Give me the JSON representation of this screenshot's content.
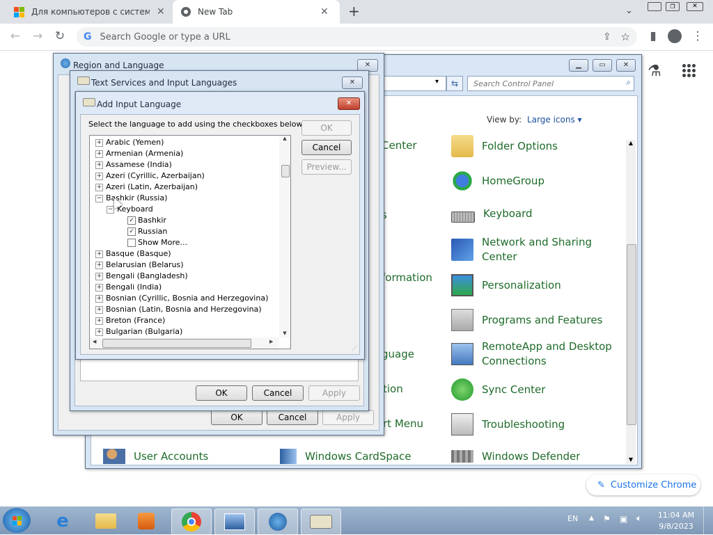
{
  "browser": {
    "tabs": [
      {
        "title": "Для компьютеров с системами"
      },
      {
        "title": "New Tab"
      }
    ],
    "new_tab_symbol": "+",
    "omnibox_placeholder": "Search Google or type a URL",
    "customize_label": "Customize Chrome"
  },
  "control_panel": {
    "search_placeholder": "Search Control Panel",
    "view_by_label": "View by:",
    "view_by_value": "Large icons",
    "items_right": [
      {
        "label": "Folder Options",
        "icon": "folder-options-icon"
      },
      {
        "label": "HomeGroup",
        "icon": "homegroup-icon"
      },
      {
        "label": "Keyboard",
        "icon": "keyboard-icon"
      },
      {
        "label": "Network and Sharing\nCenter",
        "icon": "network-icon"
      },
      {
        "label": "Personalization",
        "icon": "personalization-icon"
      },
      {
        "label": "Programs and Features",
        "icon": "programs-icon"
      },
      {
        "label": "RemoteApp and Desktop\nConnections",
        "icon": "remoteapp-icon"
      },
      {
        "label": "Sync Center",
        "icon": "sync-icon"
      },
      {
        "label": "Troubleshooting",
        "icon": "troubleshooting-icon"
      },
      {
        "label": "Windows Defender",
        "icon": "defender-icon"
      }
    ],
    "items_middle_partial": [
      "Center",
      "s",
      "formation",
      "guage",
      "tion",
      "rt Menu"
    ],
    "bottom_left": "User Accounts",
    "bottom_mid": "Windows CardSpace"
  },
  "region_dialog": {
    "title": "Region and Language",
    "ok": "OK",
    "cancel": "Cancel",
    "apply": "Apply"
  },
  "text_services_dialog": {
    "title": "Text Services and Input Languages",
    "ok": "OK",
    "cancel": "Cancel",
    "apply": "Apply"
  },
  "add_input_dialog": {
    "title": "Add Input Language",
    "instruction": "Select the language to add using the checkboxes below.",
    "ok": "OK",
    "cancel": "Cancel",
    "preview": "Preview...",
    "tree": [
      {
        "label": "Arabic (Yemen)",
        "type": "lang"
      },
      {
        "label": "Armenian (Armenia)",
        "type": "lang"
      },
      {
        "label": "Assamese (India)",
        "type": "lang"
      },
      {
        "label": "Azeri (Cyrillic, Azerbaijan)",
        "type": "lang"
      },
      {
        "label": "Azeri (Latin, Azerbaijan)",
        "type": "lang"
      },
      {
        "label": "Bashkir (Russia)",
        "type": "lang-open"
      },
      {
        "label": "Keyboard",
        "type": "group"
      },
      {
        "label": "Bashkir",
        "type": "check",
        "checked": true
      },
      {
        "label": "Russian",
        "type": "check",
        "checked": true
      },
      {
        "label": "Show More...",
        "type": "check",
        "checked": false
      },
      {
        "label": "Basque (Basque)",
        "type": "lang"
      },
      {
        "label": "Belarusian (Belarus)",
        "type": "lang"
      },
      {
        "label": "Bengali (Bangladesh)",
        "type": "lang"
      },
      {
        "label": "Bengali (India)",
        "type": "lang"
      },
      {
        "label": "Bosnian (Cyrillic, Bosnia and Herzegovina)",
        "type": "lang"
      },
      {
        "label": "Bosnian (Latin, Bosnia and Herzegovina)",
        "type": "lang"
      },
      {
        "label": "Breton (France)",
        "type": "lang"
      },
      {
        "label": "Bulgarian (Bulgaria)",
        "type": "lang"
      }
    ]
  },
  "taskbar": {
    "language": "EN",
    "time": "11:04 AM",
    "date": "9/8/2023"
  }
}
